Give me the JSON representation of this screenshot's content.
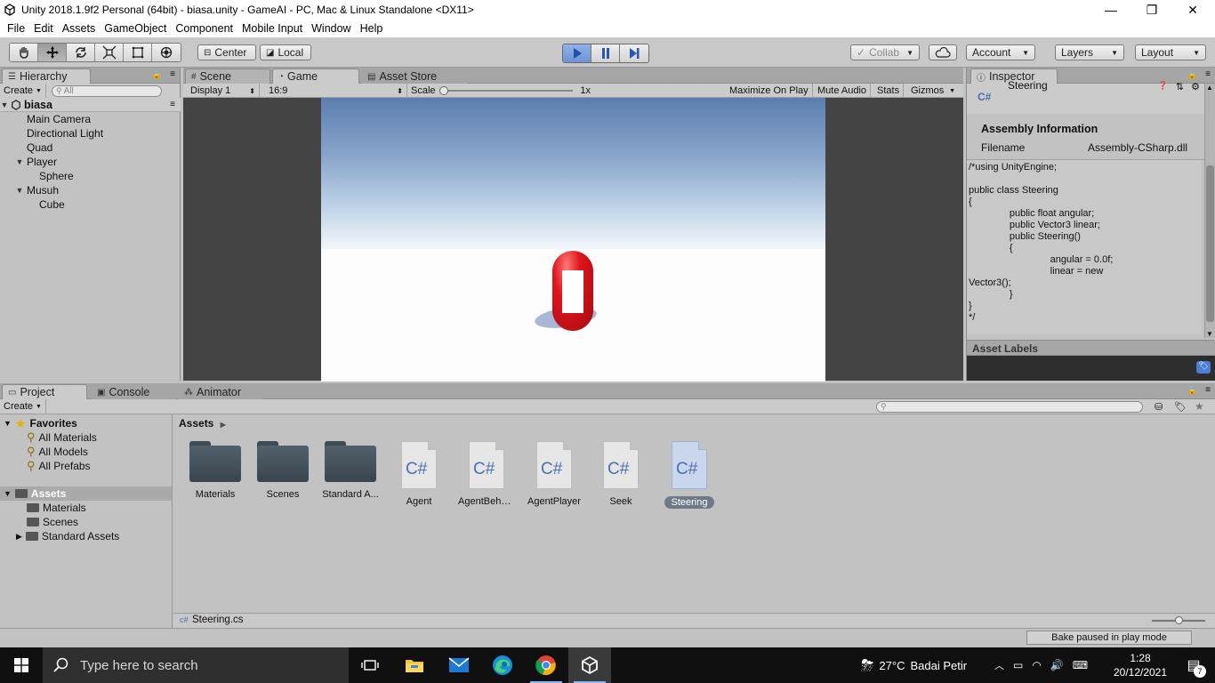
{
  "window": {
    "title": "Unity 2018.1.9f2 Personal (64bit) - biasa.unity - GameAI - PC, Mac & Linux Standalone <DX11>",
    "minimize": "—",
    "maximize": "❐",
    "close": "✕"
  },
  "menubar": [
    "File",
    "Edit",
    "Assets",
    "GameObject",
    "Component",
    "Mobile Input",
    "Window",
    "Help"
  ],
  "toolbar": {
    "pivot_label": "Center",
    "space_label": "Local",
    "collab_label": "Collab",
    "account_label": "Account",
    "layers_label": "Layers",
    "layout_label": "Layout",
    "play_state": "playing"
  },
  "hierarchy": {
    "tab_label": "Hierarchy",
    "create_label": "Create",
    "search_placeholder": "All",
    "scene_name": "biasa",
    "items": [
      {
        "label": "Main Camera",
        "indent": 1,
        "arrow": ""
      },
      {
        "label": "Directional Light",
        "indent": 1,
        "arrow": ""
      },
      {
        "label": "Quad",
        "indent": 1,
        "arrow": ""
      },
      {
        "label": "Player",
        "indent": 1,
        "arrow": "▼"
      },
      {
        "label": "Sphere",
        "indent": 2,
        "arrow": ""
      },
      {
        "label": "Musuh",
        "indent": 1,
        "arrow": "▼"
      },
      {
        "label": "Cube",
        "indent": 2,
        "arrow": ""
      }
    ]
  },
  "center_tabs": {
    "scene": "Scene",
    "game": "Game",
    "asset_store": "Asset Store"
  },
  "game_toolbar": {
    "display": "Display 1",
    "aspect": "16:9",
    "scale_label": "Scale",
    "scale_value": "1x",
    "maximize": "Maximize On Play",
    "mute": "Mute Audio",
    "stats": "Stats",
    "gizmos": "Gizmos"
  },
  "inspector": {
    "tab_label": "Inspector",
    "asset_name": "Steering",
    "file_icon": "C#",
    "section_title": "Assembly Information",
    "filename_label": "Filename",
    "filename_value": "Assembly-CSharp.dll",
    "code": "/*using UnityEngine;\n\npublic class Steering\n{\n               public float angular;\n               public Vector3 linear;\n               public Steering()\n               {\n                              angular = 0.0f;\n                              linear = new\nVector3();\n               }\n}\n*/",
    "asset_labels": "Asset Labels"
  },
  "bottom_tabs": {
    "project": "Project",
    "console": "Console",
    "animator": "Animator"
  },
  "project": {
    "create_label": "Create",
    "favorites_label": "Favorites",
    "favorites": [
      "All Materials",
      "All Models",
      "All Prefabs"
    ],
    "assets_label": "Assets",
    "asset_folders": [
      "Materials",
      "Scenes",
      "Standard Assets"
    ],
    "breadcrumb": "Assets",
    "tiles": [
      {
        "label": "Materials",
        "kind": "folder"
      },
      {
        "label": "Scenes",
        "kind": "folder"
      },
      {
        "label": "Standard A...",
        "kind": "folder"
      },
      {
        "label": "Agent",
        "kind": "script"
      },
      {
        "label": "AgentBehav...",
        "kind": "script"
      },
      {
        "label": "AgentPlayer",
        "kind": "script"
      },
      {
        "label": "Seek",
        "kind": "script"
      },
      {
        "label": "Steering",
        "kind": "script"
      }
    ],
    "selected_file": "Steering.cs"
  },
  "statusbar": {
    "message": "Bake paused in play mode"
  },
  "taskbar": {
    "search_placeholder": "Type here to search",
    "weather_temp": "27°C",
    "weather_text": "Badai Petir",
    "time": "1:28",
    "date": "20/12/2021",
    "notifications": "7"
  },
  "colors": {
    "editor_bg": "#c2c2c2",
    "play_accent": "#6e94d8",
    "taskbar": "#101010",
    "capsule_red": "#e0141c"
  }
}
